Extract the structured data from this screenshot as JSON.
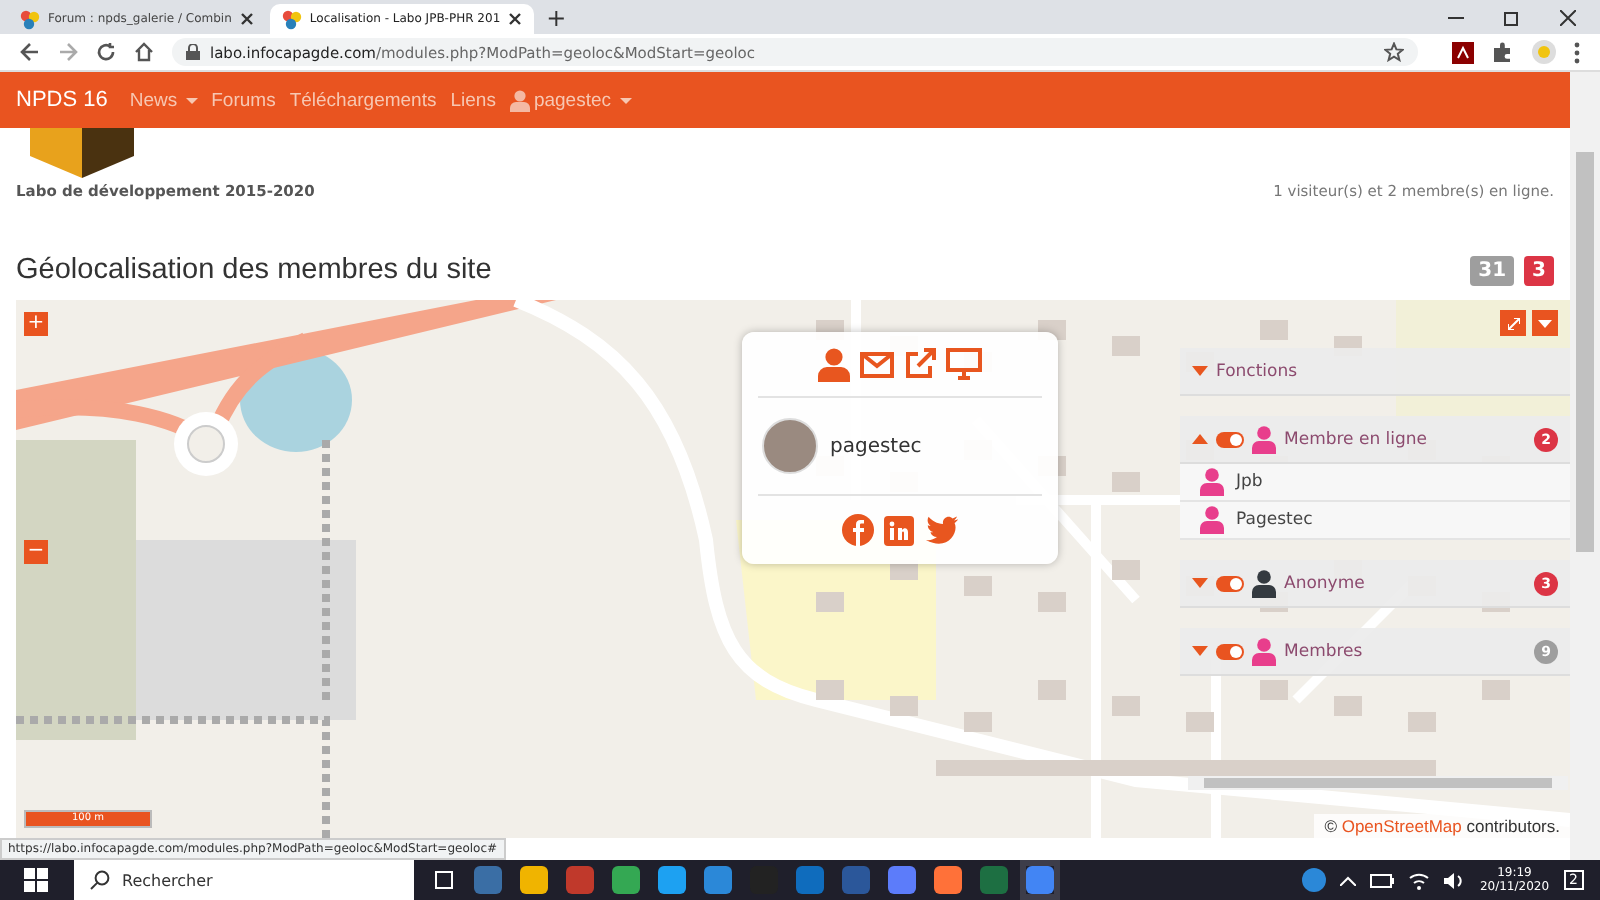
{
  "browser": {
    "tabs": [
      {
        "title": "Forum : npds_galerie / Combin",
        "selected": false
      },
      {
        "title": "Localisation - Labo JPB-PHR 201",
        "selected": true
      }
    ],
    "new_tab": "+",
    "url_host": "labo.infocapagde.com",
    "url_path": "/modules.php?ModPath=geoloc&ModStart=geoloc"
  },
  "navbar": {
    "brand": "NPDS 16",
    "items": [
      {
        "label": "News",
        "dropdown": true
      },
      {
        "label": "Forums",
        "dropdown": false
      },
      {
        "label": "Téléchargements",
        "dropdown": false
      },
      {
        "label": "Liens",
        "dropdown": false
      }
    ],
    "user": "pagestec"
  },
  "site": {
    "subtitle": "Labo de développement 2015-2020",
    "online_text": "1 visiteur(s) et 2 membre(s) en ligne."
  },
  "page": {
    "title": "Géolocalisation des membres du site",
    "badges": [
      {
        "text": "31",
        "color": "#9e9e9e"
      },
      {
        "text": "3",
        "color": "#dc3545"
      }
    ]
  },
  "map": {
    "zoom_in": "+",
    "zoom_out": "−",
    "popup": {
      "username": "pagestec"
    },
    "groups": [
      {
        "kind": "plain",
        "label": "Fonctions",
        "expanded": false
      },
      {
        "kind": "layer",
        "label": "Membre en ligne",
        "expanded": true,
        "toggle_on": true,
        "color": "#e83e8c",
        "count": {
          "text": "2",
          "color": "#dc3545"
        },
        "members": [
          {
            "name": "Jpb"
          },
          {
            "name": "Pagestec"
          }
        ]
      },
      {
        "kind": "layer",
        "label": "Anonyme",
        "expanded": false,
        "toggle_on": true,
        "color": "#343a40",
        "count": {
          "text": "3",
          "color": "#dc3545"
        }
      },
      {
        "kind": "layer",
        "label": "Membres",
        "expanded": false,
        "toggle_on": true,
        "color": "#e83e8c",
        "count": {
          "text": "9",
          "color": "#9e9e9e"
        }
      }
    ],
    "scale": "100 m",
    "attribution_symbol": "©",
    "attribution_link": "OpenStreetMap",
    "attribution_text": "contributors."
  },
  "status_url": "https://labo.infocapagde.com/modules.php?ModPath=geoloc&ModStart=geoloc#",
  "taskbar": {
    "search_placeholder": "Rechercher",
    "time": "19:19",
    "date": "20/11/2020",
    "notifications": "2"
  }
}
